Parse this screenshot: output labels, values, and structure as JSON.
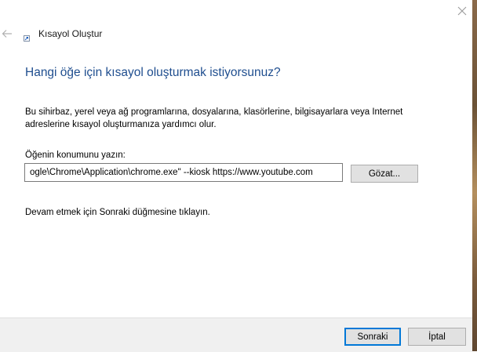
{
  "window": {
    "title": "Kısayol Oluştur"
  },
  "wizard": {
    "heading": "Hangi öğe için kısayol oluşturmak istiyorsunuz?",
    "description": "Bu sihirbaz, yerel veya ağ programlarına, dosyalarına, klasörlerine, bilgisayarlara veya Internet adreslerine kısayol oluşturmanıza yardımcı olur.",
    "location_label": "Öğenin konumunu yazın:",
    "location_value": "ogle\\Chrome\\Application\\chrome.exe\"  --kiosk https://www.youtube.com",
    "browse_label": "Gözat...",
    "hint": "Devam etmek için Sonraki düğmesine tıklayın."
  },
  "footer": {
    "next_label": "Sonraki",
    "cancel_label": "İptal"
  },
  "icons": {
    "close": "close-icon",
    "back": "back-arrow-icon",
    "app": "shortcut-app-icon"
  }
}
